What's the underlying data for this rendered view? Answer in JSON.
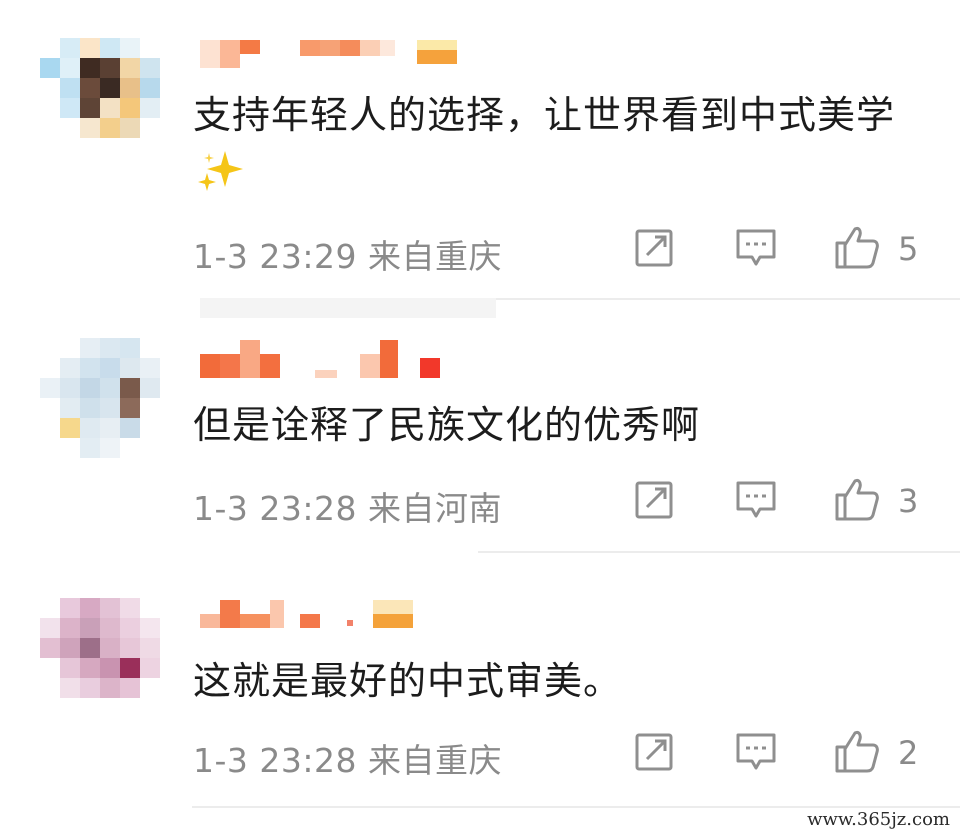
{
  "comments": [
    {
      "text": "支持年轻人的选择，让世界看到中式美学",
      "emoji_icon": "sparkles-icon",
      "meta": "1-3 23:29 来自重庆",
      "likes": "5"
    },
    {
      "text": "但是诠释了民族文化的优秀啊",
      "meta": "1-3 23:28 来自河南",
      "likes": "3"
    },
    {
      "text": "这就是最好的中式审美。",
      "meta": "1-3 23:28 来自重庆",
      "likes": "2"
    }
  ],
  "icons": {
    "share": "share-icon",
    "reply": "reply-icon",
    "like": "thumbs-up-icon"
  },
  "colors": {
    "text": "#1c1c1c",
    "meta": "#8a8a8a",
    "icon": "#8f8f8f",
    "divider": "#ececec",
    "sparkle": "#f5c518"
  },
  "watermark": "www.365jz.com"
}
